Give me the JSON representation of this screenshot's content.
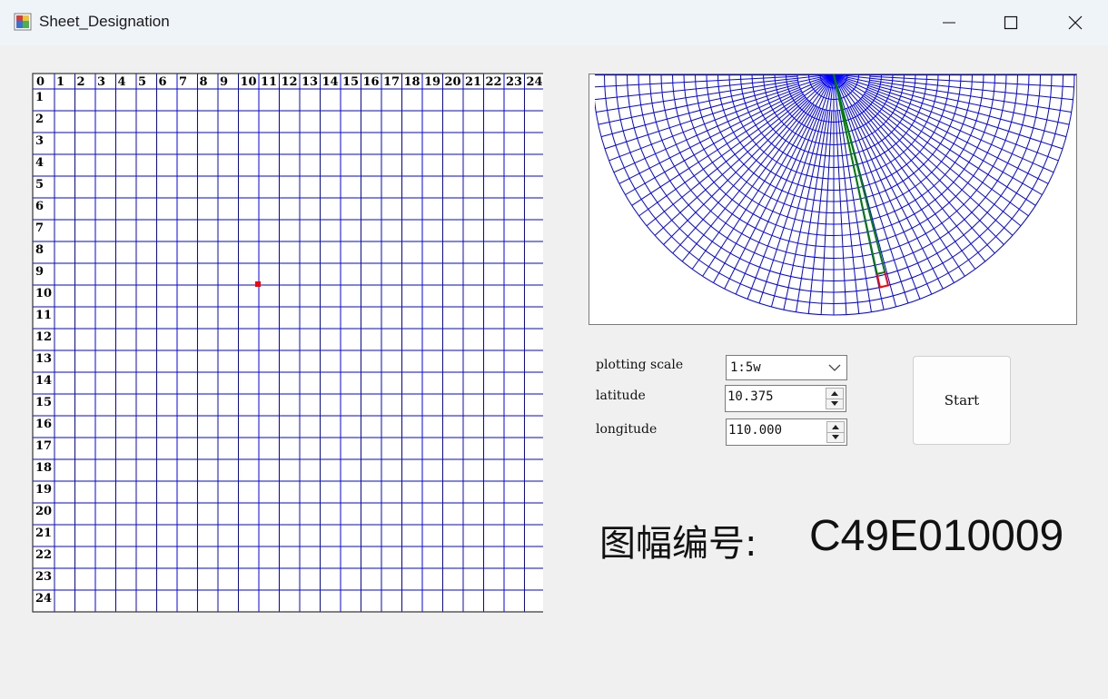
{
  "window": {
    "title": "Sheet_Designation",
    "app_icon": "app-icon",
    "controls": [
      "minimize-icon",
      "maximize-icon",
      "close-icon"
    ]
  },
  "grid": {
    "column_labels": [
      "0",
      "1",
      "2",
      "3",
      "4",
      "5",
      "6",
      "7",
      "8",
      "9",
      "10",
      "11",
      "12",
      "13",
      "14",
      "15",
      "16",
      "17",
      "18",
      "19",
      "20",
      "21",
      "22",
      "23",
      "24"
    ],
    "row_labels": [
      "1",
      "2",
      "3",
      "4",
      "5",
      "6",
      "7",
      "8",
      "9",
      "10",
      "11",
      "12",
      "13",
      "14",
      "15",
      "16",
      "17",
      "18",
      "19",
      "20",
      "21",
      "22",
      "23",
      "24"
    ],
    "grid_color": "#0000ff",
    "marker_color": "#ff0000",
    "marker": {
      "column": 10,
      "row": 9
    }
  },
  "map": {
    "line_color": "#0000ff",
    "strip_color": "#008000",
    "sheet_color": "#ff0000"
  },
  "form": {
    "scale_label": "plotting scale",
    "scale_value": "1:5w",
    "latitude_label": "latitude",
    "latitude_value": "10.375",
    "longitude_label": "longitude",
    "longitude_value": "110.000",
    "start_label": "Start"
  },
  "result": {
    "label": "图幅编号:",
    "value": "C49E010009"
  }
}
